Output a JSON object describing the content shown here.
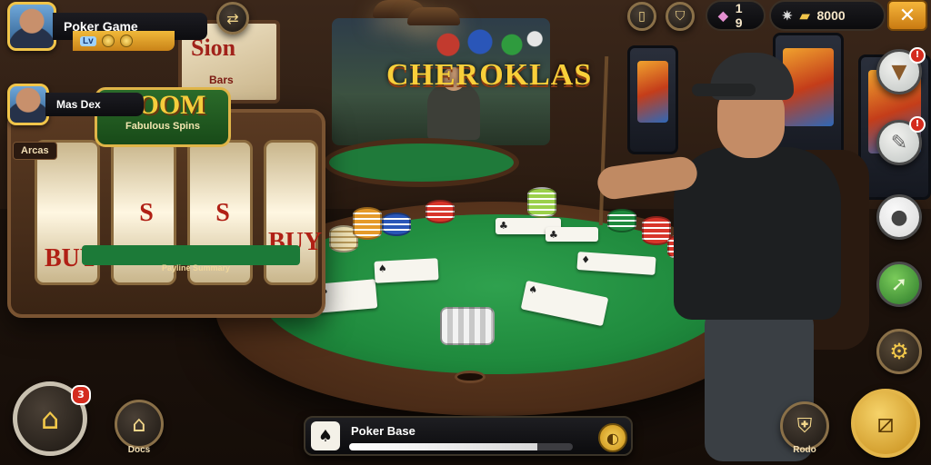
{
  "game": {
    "title": "CHEROKLAS"
  },
  "hud": {
    "player_name": "Poker Game",
    "level_badge": "Lv",
    "opponent_name": "Mas Dex",
    "gem_count": "1 9",
    "coin_balance": "8000",
    "accent_color": "#f1c54a"
  },
  "slot_machine": {
    "logo_title": "BOOM",
    "logo_subtitle": "Fabulous Spins",
    "label": "Arcas",
    "plate": "Payline Summary",
    "reel_symbols": [
      "BUY",
      "S",
      "S",
      "BUY"
    ]
  },
  "wall_sign": {
    "line1": "Sion",
    "line2": "Bars"
  },
  "bottom": {
    "home_badge": "3",
    "left_button_label": "Docs",
    "right_button_label": "Rodo"
  },
  "status": {
    "title": "Poker Base",
    "progress": 0.84
  },
  "side_menu": {
    "notification_badge": "!"
  }
}
